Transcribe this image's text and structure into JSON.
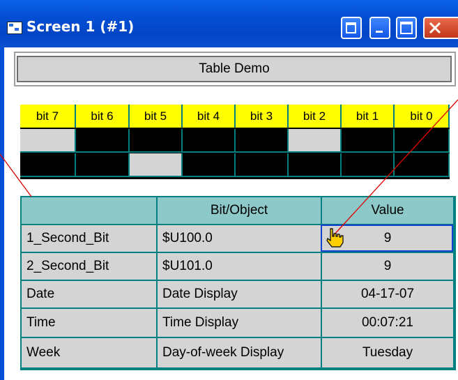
{
  "window": {
    "title": "Screen 1 (#1)",
    "accent": "#0550d6"
  },
  "banner": {
    "label": "Table Demo"
  },
  "bits": {
    "headers": [
      "bit 7",
      "bit 6",
      "bit 5",
      "bit 4",
      "bit 3",
      "bit 2",
      "bit 1",
      "bit 0"
    ],
    "row1": [
      1,
      0,
      0,
      0,
      0,
      1,
      0,
      0
    ],
    "row2": [
      0,
      0,
      1,
      0,
      0,
      0,
      0,
      0
    ],
    "on_color": "#d4d4d4",
    "off_color": "#000000",
    "header_color": "#ffff00"
  },
  "table": {
    "columns": [
      "",
      "Bit/Object",
      "Value"
    ],
    "rows": [
      [
        "1_Second_Bit",
        "$U100.0",
        "9"
      ],
      [
        "2_Second_Bit",
        "$U101.0",
        "9"
      ],
      [
        "Date",
        "Date Display",
        "04-17-07"
      ],
      [
        "Time",
        "Time Display",
        "00:07:21"
      ],
      [
        "Week",
        "Day-of-week Display",
        "Tuesday"
      ]
    ],
    "header_color": "#8ec9c9",
    "border_color": "#008080"
  },
  "icons": {
    "app": "screen-icon",
    "restore": "restore-icon",
    "minimize": "minimize-icon",
    "maximize": "maximize-icon",
    "close": "close-icon",
    "cursor": "hand-cursor-icon"
  }
}
